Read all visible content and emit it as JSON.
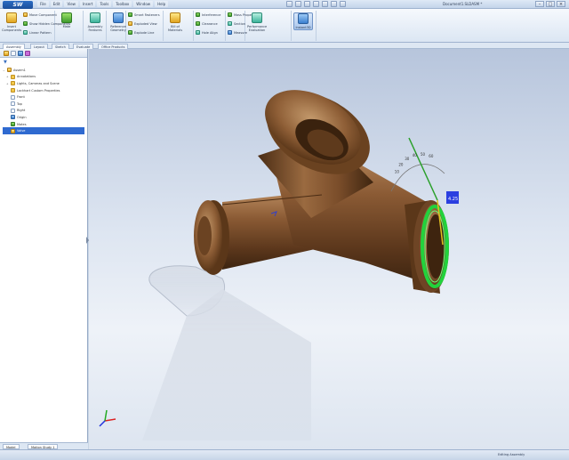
{
  "app": {
    "logo_text": "SW",
    "document_title": "Document1.SLDASM *"
  },
  "menubar": {
    "items": [
      "File",
      "Edit",
      "View",
      "Insert",
      "Tools",
      "Toolbox",
      "Window",
      "Help"
    ]
  },
  "ribbon": {
    "groups": [
      {
        "big": "Insert Components",
        "smalls": [
          "Move Component",
          "Show Hidden Components",
          "Linear Pattern"
        ]
      },
      {
        "big": "Mate",
        "smalls": []
      },
      {
        "big": "Assembly Features",
        "smalls": []
      },
      {
        "big": "Reference Geometry",
        "smalls": []
      },
      {
        "big": "",
        "smalls": [
          "Smart Fasteners",
          "Exploded View",
          "Explode Line"
        ]
      },
      {
        "big": "Bill of Materials",
        "smalls": []
      },
      {
        "big": "",
        "smalls": [
          "Interference",
          "Clearance",
          "Hole Align"
        ]
      },
      {
        "big": "",
        "smalls": [
          "Mass Properties",
          "Section",
          "Measure"
        ]
      },
      {
        "big": "Performance Evaluation",
        "smalls": []
      },
      {
        "big": "Instant3D",
        "smalls": []
      }
    ]
  },
  "doc_tabs": [
    "Assembly",
    "Layout",
    "Sketch",
    "Evaluate",
    "Office Products"
  ],
  "feature_manager": {
    "filter_icon": "filter-icon",
    "tree": [
      {
        "label": "Assem1",
        "icon": "assembly-icon",
        "exp": "−"
      },
      {
        "label": "Annotations",
        "icon": "folder-icon",
        "exp": "+"
      },
      {
        "label": "Lights, Cameras and Scene",
        "icon": "folder-icon",
        "exp": "+"
      },
      {
        "label": "Lockhart Custom Properties",
        "icon": "folder-icon",
        "exp": ""
      },
      {
        "label": "Front",
        "icon": "plane-icon",
        "exp": ""
      },
      {
        "label": "Top",
        "icon": "plane-icon",
        "exp": ""
      },
      {
        "label": "Right",
        "icon": "plane-icon",
        "exp": ""
      },
      {
        "label": "Origin",
        "icon": "origin-icon",
        "exp": ""
      },
      {
        "label": "Mates",
        "icon": "mates-icon",
        "exp": ""
      },
      {
        "label": "Valve",
        "icon": "part-icon",
        "exp": "",
        "selected": true
      }
    ],
    "bottom_tabs": [
      "Model",
      "Motion Study 1"
    ]
  },
  "viewport": {
    "triad_label": "triad-icon",
    "ruler_ticks": [
      "10",
      "20",
      "30",
      "40",
      "50",
      "60"
    ],
    "dimension_label": "4.25"
  },
  "status": {
    "left": "",
    "right": "Editing Assembly"
  },
  "colors": {
    "model_bronze": "#7a4d2a",
    "highlight_green": "#22d23c",
    "accent_blue": "#2f6ad0"
  }
}
